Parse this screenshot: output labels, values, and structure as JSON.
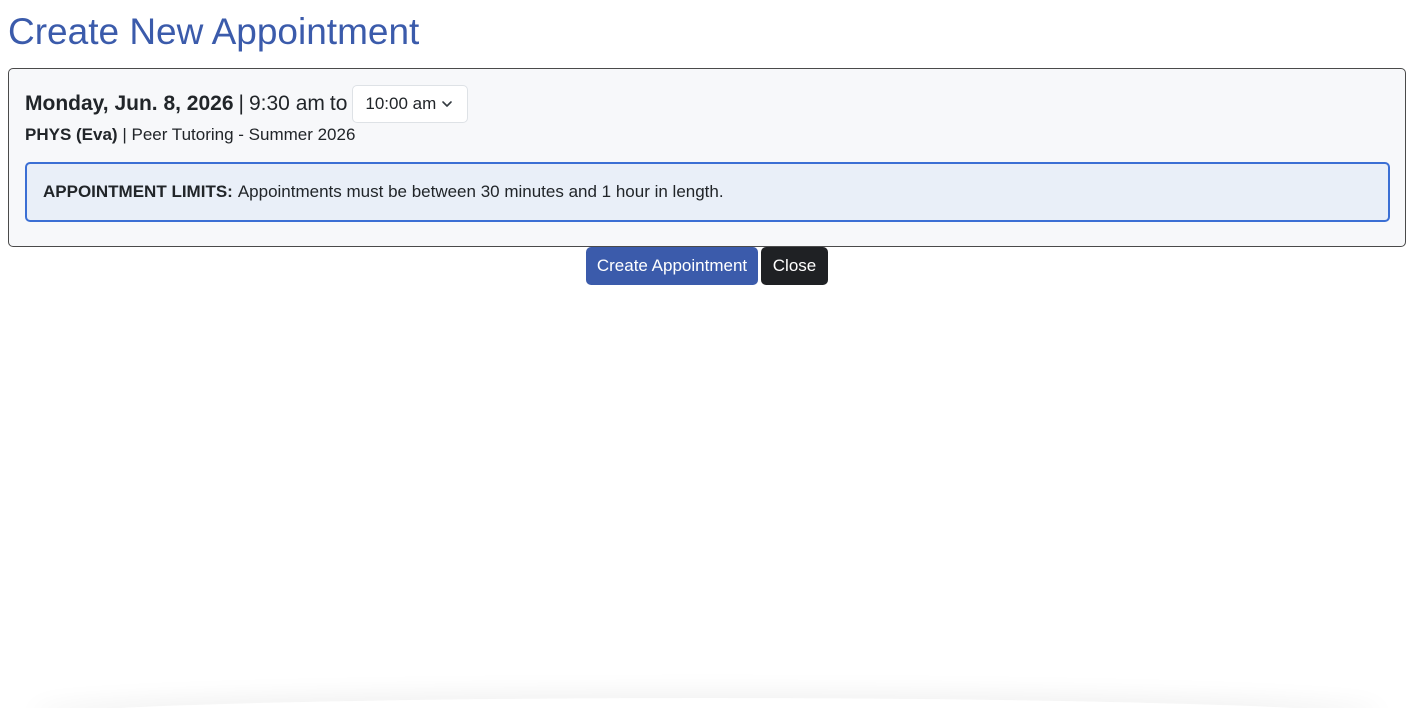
{
  "page": {
    "title": "Create New Appointment"
  },
  "appointment": {
    "date": "Monday, Jun. 8, 2026",
    "separator": "|",
    "start_time": "9:30 am",
    "to_word": "to",
    "end_time_selected": "10:00 am",
    "course": "PHYS (Eva)",
    "course_separator": "|",
    "session": "Peer Tutoring - Summer 2026"
  },
  "alert": {
    "label": "APPOINTMENT LIMITS:",
    "message": "Appointments must be between 30 minutes and 1 hour in length."
  },
  "actions": {
    "create_label": "Create Appointment",
    "close_label": "Close"
  },
  "colors": {
    "title": "#3b5bab",
    "primary_button": "#3b5bab",
    "dark_button": "#1f2124",
    "alert_border": "#3b6fd4",
    "alert_background": "#e9eff8"
  },
  "icons": {
    "select_arrow": "chevron-down-icon"
  }
}
